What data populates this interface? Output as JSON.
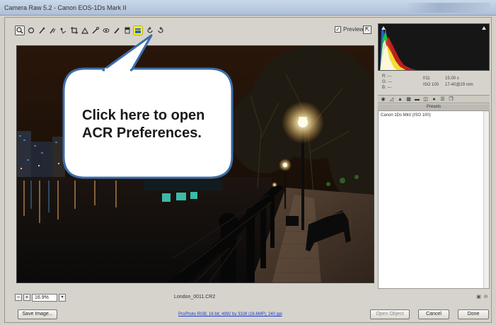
{
  "window": {
    "title": "Camera Raw 5.2  -  Canon EOS-1Ds Mark II"
  },
  "toolbar": {
    "tools": [
      "zoom-tool-icon",
      "hand-tool-icon",
      "white-balance-tool-icon",
      "color-sampler-tool-icon",
      "targeted-adjustment-tool-icon",
      "crop-tool-icon",
      "straighten-tool-icon",
      "spot-removal-tool-icon",
      "red-eye-removal-tool-icon",
      "adjustment-brush-icon",
      "graduated-filter-icon",
      "preferences-icon",
      "rotate-left-icon",
      "rotate-right-icon"
    ],
    "preview_label": "Preview",
    "preview_checked": true,
    "highlight_color": "#f5f13a"
  },
  "callout": {
    "text_line1": "Click here to open",
    "text_line2": "ACR Preferences."
  },
  "viewbar": {
    "zoom_value": "16.9%",
    "filename": "London_0011.CR2"
  },
  "info": {
    "r_label": "R:",
    "g_label": "G:",
    "b_label": "B:",
    "r_value": "---",
    "g_value": "---",
    "b_value": "---",
    "aperture": "f/11",
    "shutter": "15.00 s",
    "iso": "ISO 100",
    "lens": "17-40@29 mm"
  },
  "presets": {
    "header": "Presets",
    "items": [
      "Canon 1Ds MkII (ISO 100)"
    ]
  },
  "bottombar": {
    "save_label": "Save Image...",
    "workflow_text": "ProPhoto RGB; 16 bit; 4992 by 3328 (16.6MP); 240 ppi",
    "open_label": "Open Object",
    "cancel_label": "Cancel",
    "done_label": "Done"
  },
  "colors": {
    "link": "#1a3ac9",
    "callout_bg": "#ffffff",
    "callout_border": "#3d6da8"
  }
}
